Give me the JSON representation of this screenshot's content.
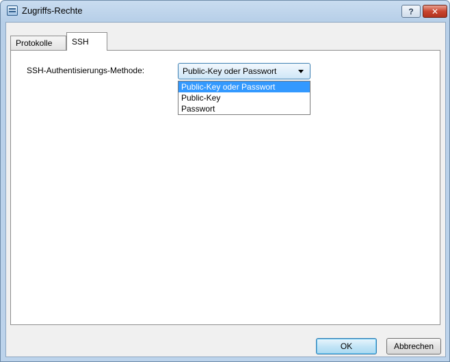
{
  "window": {
    "title": "Zugriffs-Rechte",
    "help_label": "?",
    "close_label": "✕"
  },
  "tabs": [
    {
      "label": "Protokolle",
      "active": false
    },
    {
      "label": "SSH",
      "active": true
    }
  ],
  "ssh": {
    "method_label": "SSH-Authentisierungs-Methode:",
    "selected_value": "Public-Key oder Passwort",
    "options": [
      "Public-Key oder Passwort",
      "Public-Key",
      "Passwort"
    ],
    "highlighted_option": "Public-Key oder Passwort"
  },
  "buttons": {
    "ok_label": "OK",
    "cancel_label": "Abbrechen"
  },
  "colors": {
    "selection": "#3399ff",
    "title_gradient": "#c9dcf0",
    "close_button": "#c8452f"
  },
  "icons": {
    "app": "window-icon",
    "dropdown": "caret-down-icon"
  }
}
